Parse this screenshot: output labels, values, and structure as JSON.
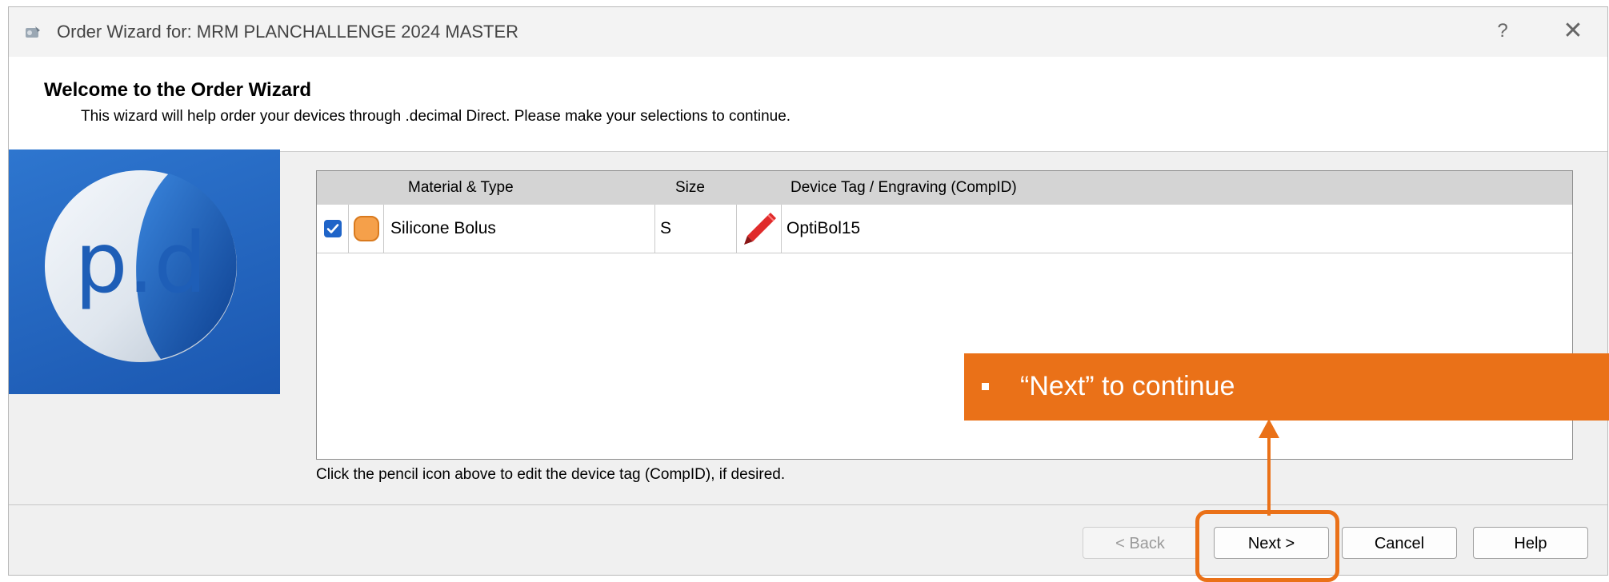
{
  "window": {
    "title": "Order Wizard for: MRM PLANCHALLENGE 2024 MASTER",
    "help_glyph": "?",
    "close_glyph": "✕"
  },
  "header": {
    "heading": "Welcome to the Order Wizard",
    "subtitle": "This wizard will help order your devices through .decimal Direct. Please make your selections to continue."
  },
  "logo": {
    "text": "p.d"
  },
  "grid": {
    "columns": [
      "Material & Type",
      "Size",
      "Device Tag / Engraving (CompID)"
    ],
    "rows": [
      {
        "checked": true,
        "material": "Silicone Bolus",
        "size": "S",
        "device_tag": "OptiBol15"
      }
    ]
  },
  "hint": "Click the pencil icon above to edit the device tag (CompID), if desired.",
  "buttons": {
    "back": "< Back",
    "next": "Next >",
    "cancel": "Cancel",
    "help": "Help"
  },
  "callout": {
    "text": "“Next” to continue"
  },
  "colors": {
    "accent": "#ea7118",
    "logo_blue": "#1f5fbd",
    "check_blue": "#1f64c8",
    "swatch_orange": "#f5a04a",
    "pencil_red": "#e02b2b"
  }
}
